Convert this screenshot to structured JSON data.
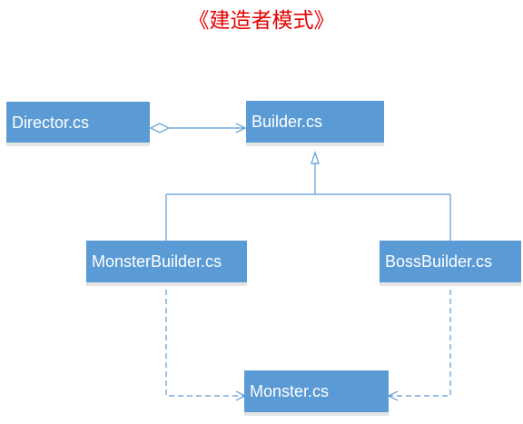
{
  "title": "《建造者模式》",
  "colors": {
    "title": "#e60000",
    "box_fill": "#5b9bd5",
    "line": "#5b9bd5"
  },
  "nodes": [
    {
      "id": "director",
      "label": "Director.cs"
    },
    {
      "id": "builder",
      "label": "Builder.cs"
    },
    {
      "id": "monster_builder",
      "label": "MonsterBuilder.cs"
    },
    {
      "id": "boss_builder",
      "label": "BossBuilder.cs"
    },
    {
      "id": "monster",
      "label": "Monster.cs"
    }
  ],
  "edges": [
    {
      "from": "director",
      "to": "builder",
      "type": "aggregation"
    },
    {
      "from": "monster_builder",
      "to": "builder",
      "type": "inheritance"
    },
    {
      "from": "boss_builder",
      "to": "builder",
      "type": "inheritance"
    },
    {
      "from": "monster_builder",
      "to": "monster",
      "type": "dependency"
    },
    {
      "from": "boss_builder",
      "to": "monster",
      "type": "dependency"
    }
  ]
}
